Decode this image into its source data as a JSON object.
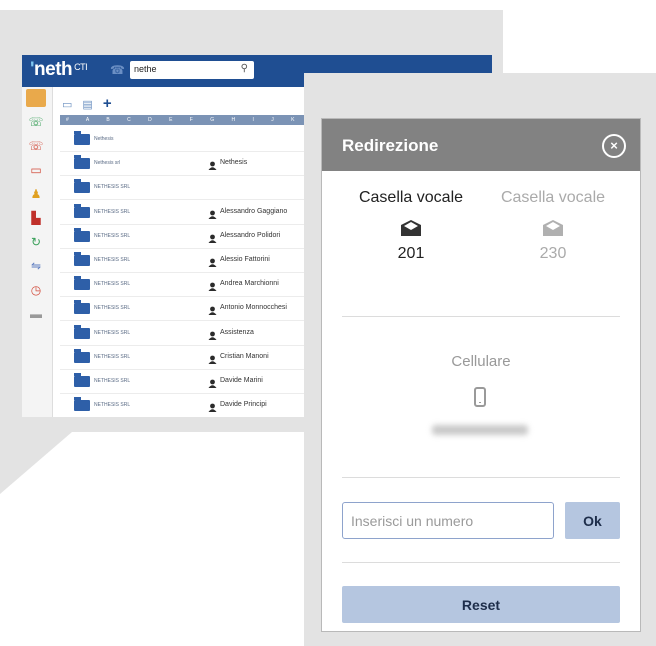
{
  "app": {
    "logo": "neth",
    "logo_apos": "'",
    "logo_sup": "CTI",
    "search_value": "nethe"
  },
  "alphabet": "# A B C D E F G H I J K L",
  "contacts": [
    {
      "company": "Nethesis",
      "person": ""
    },
    {
      "company": "Nethesis srl",
      "person": "Nethesis"
    },
    {
      "company": "NETHESIS SRL",
      "person": ""
    },
    {
      "company": "NETHESIS SRL",
      "person": "Alessandro Gaggiano"
    },
    {
      "company": "NETHESIS SRL",
      "person": "Alessandro Polidori"
    },
    {
      "company": "NETHESIS SRL",
      "person": "Alessio Fattorini"
    },
    {
      "company": "NETHESIS SRL",
      "person": "Andrea Marchionni"
    },
    {
      "company": "NETHESIS SRL",
      "person": "Antonio Monnocchesi"
    },
    {
      "company": "NETHESIS SRL",
      "person": "Assistenza"
    },
    {
      "company": "NETHESIS SRL",
      "person": "Cristian Manoni"
    },
    {
      "company": "NETHESIS SRL",
      "person": "Davide Marini"
    },
    {
      "company": "NETHESIS SRL",
      "person": "Davide Principi"
    }
  ],
  "dialog": {
    "title": "Redirezione",
    "voicemail_1": {
      "label": "Casella vocale",
      "number": "201"
    },
    "voicemail_2": {
      "label": "Casella vocale",
      "number": "230"
    },
    "mobile_label": "Cellulare",
    "input_placeholder": "Inserisci un numero",
    "ok_label": "Ok",
    "reset_label": "Reset"
  },
  "colors": {
    "header_blue": "#1f4e92",
    "dialog_header": "#828282",
    "button_bg": "#b5c6e0"
  }
}
